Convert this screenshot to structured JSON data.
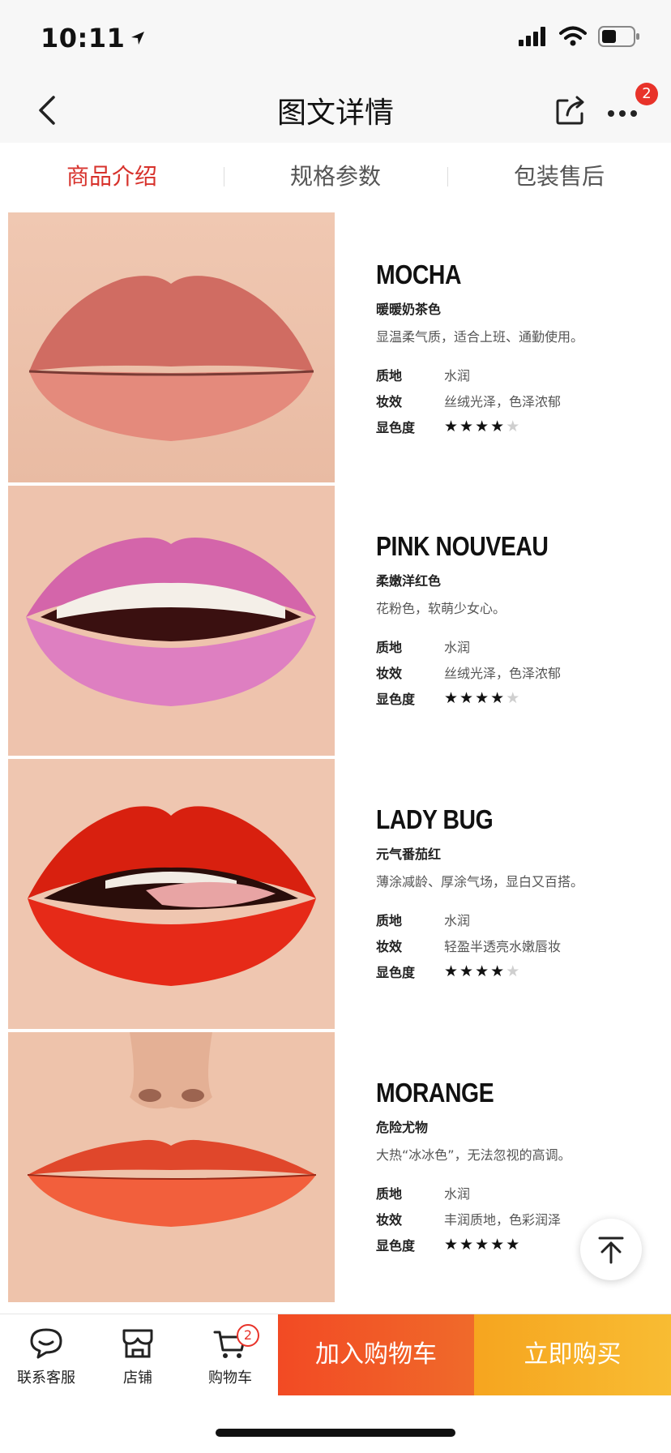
{
  "status_bar": {
    "time": "10:11"
  },
  "nav": {
    "title": "图文详情",
    "badge": "2"
  },
  "tabs": [
    {
      "label": "商品介绍",
      "active": true
    },
    {
      "label": "规格参数",
      "active": false
    },
    {
      "label": "包装售后",
      "active": false
    }
  ],
  "products": [
    {
      "name": "MOCHA",
      "subtitle": "暖暖奶茶色",
      "desc": "显温柔气质，适合上班、通勤使用。",
      "specs": [
        {
          "key": "质地",
          "value": "水润"
        },
        {
          "key": "妆效",
          "value": "丝绒光泽，色泽浓郁"
        },
        {
          "key": "显色度",
          "rating": 4
        }
      ],
      "lip_color": "#d77a6e"
    },
    {
      "name": "PINK NOUVEAU",
      "subtitle": "柔嫩洋红色",
      "desc": "花粉色，软萌少女心。",
      "specs": [
        {
          "key": "质地",
          "value": "水润"
        },
        {
          "key": "妆效",
          "value": "丝绒光泽，色泽浓郁"
        },
        {
          "key": "显色度",
          "rating": 4
        }
      ],
      "lip_color": "#d766b1"
    },
    {
      "name": "LADY BUG",
      "subtitle": "元气番茄红",
      "desc": "薄涂减龄、厚涂气场，显白又百搭。",
      "specs": [
        {
          "key": "质地",
          "value": "水润"
        },
        {
          "key": "妆效",
          "value": "轻盈半透亮水嫩唇妆"
        },
        {
          "key": "显色度",
          "rating": 4
        }
      ],
      "lip_color": "#dd1f12"
    },
    {
      "name": "MORANGE",
      "subtitle": "危险尤物",
      "desc": "大热“冰冰色”，无法忽视的高调。",
      "specs": [
        {
          "key": "质地",
          "value": "水润"
        },
        {
          "key": "妆效",
          "value": "丰润质地，色彩润泽"
        },
        {
          "key": "显色度",
          "rating": 5
        }
      ],
      "lip_color": "#ee5533"
    }
  ],
  "rating_max": 5,
  "bottom_bar": {
    "service_label": "联系客服",
    "shop_label": "店铺",
    "cart_label": "购物车",
    "cart_badge": "2",
    "add_to_cart": "加入购物车",
    "buy_now": "立即购买"
  },
  "colors": {
    "accent": "#d7322c",
    "cart_button": "#f24a24",
    "buy_button": "#f8b52b"
  }
}
